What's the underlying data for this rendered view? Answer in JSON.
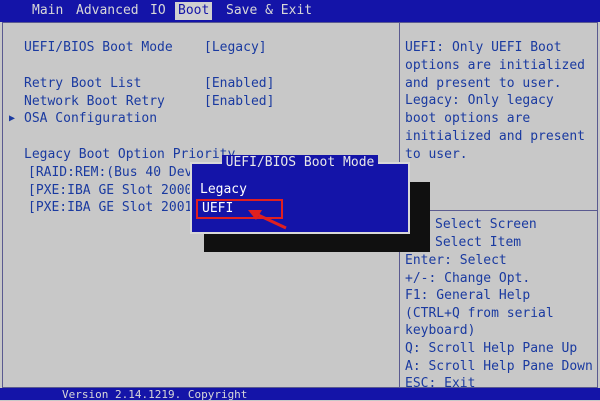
{
  "menu": {
    "tabs": [
      "Main",
      "Advanced",
      "IO",
      "Boot",
      "Save & Exit"
    ],
    "active_tab": "Boot"
  },
  "settings": {
    "boot_mode_label": "UEFI/BIOS Boot Mode",
    "boot_mode_value": "[Legacy]",
    "retry_label": "Retry Boot List",
    "retry_value": "[Enabled]",
    "net_retry_label": "Network Boot Retry",
    "net_retry_value": "[Enabled]",
    "osa_label": "OSA Configuration",
    "legacy_priority_label": "Legacy Boot Option Priority",
    "boot_options": [
      "[RAID:REM:(Bus 40 Dev",
      "[PXE:IBA GE Slot 2000",
      "[PXE:IBA GE Slot 2001"
    ]
  },
  "help_text": [
    "UEFI: Only UEFI Boot",
    "options are initialized",
    "and present to user.",
    "Legacy: Only legacy",
    "boot options are",
    "initialized and present",
    "to user."
  ],
  "key_help": [
    "Select Screen",
    "Select Item",
    "Enter: Select",
    "+/-: Change Opt.",
    "F1: General Help",
    "(CTRL+Q from serial",
    "keyboard)",
    "Q: Scroll Help Pane Up",
    "A: Scroll Help Pane Down",
    "ESC: Exit"
  ],
  "popup": {
    "title": "UEFI/BIOS Boot Mode",
    "options": [
      "Legacy",
      "UEFI"
    ],
    "selected": "UEFI"
  },
  "footer": "Version 2.14.1219. Copyright",
  "colors": {
    "bios_blue": "#1414a8",
    "background": "#c8c8c8",
    "highlight_red": "#e02020"
  }
}
